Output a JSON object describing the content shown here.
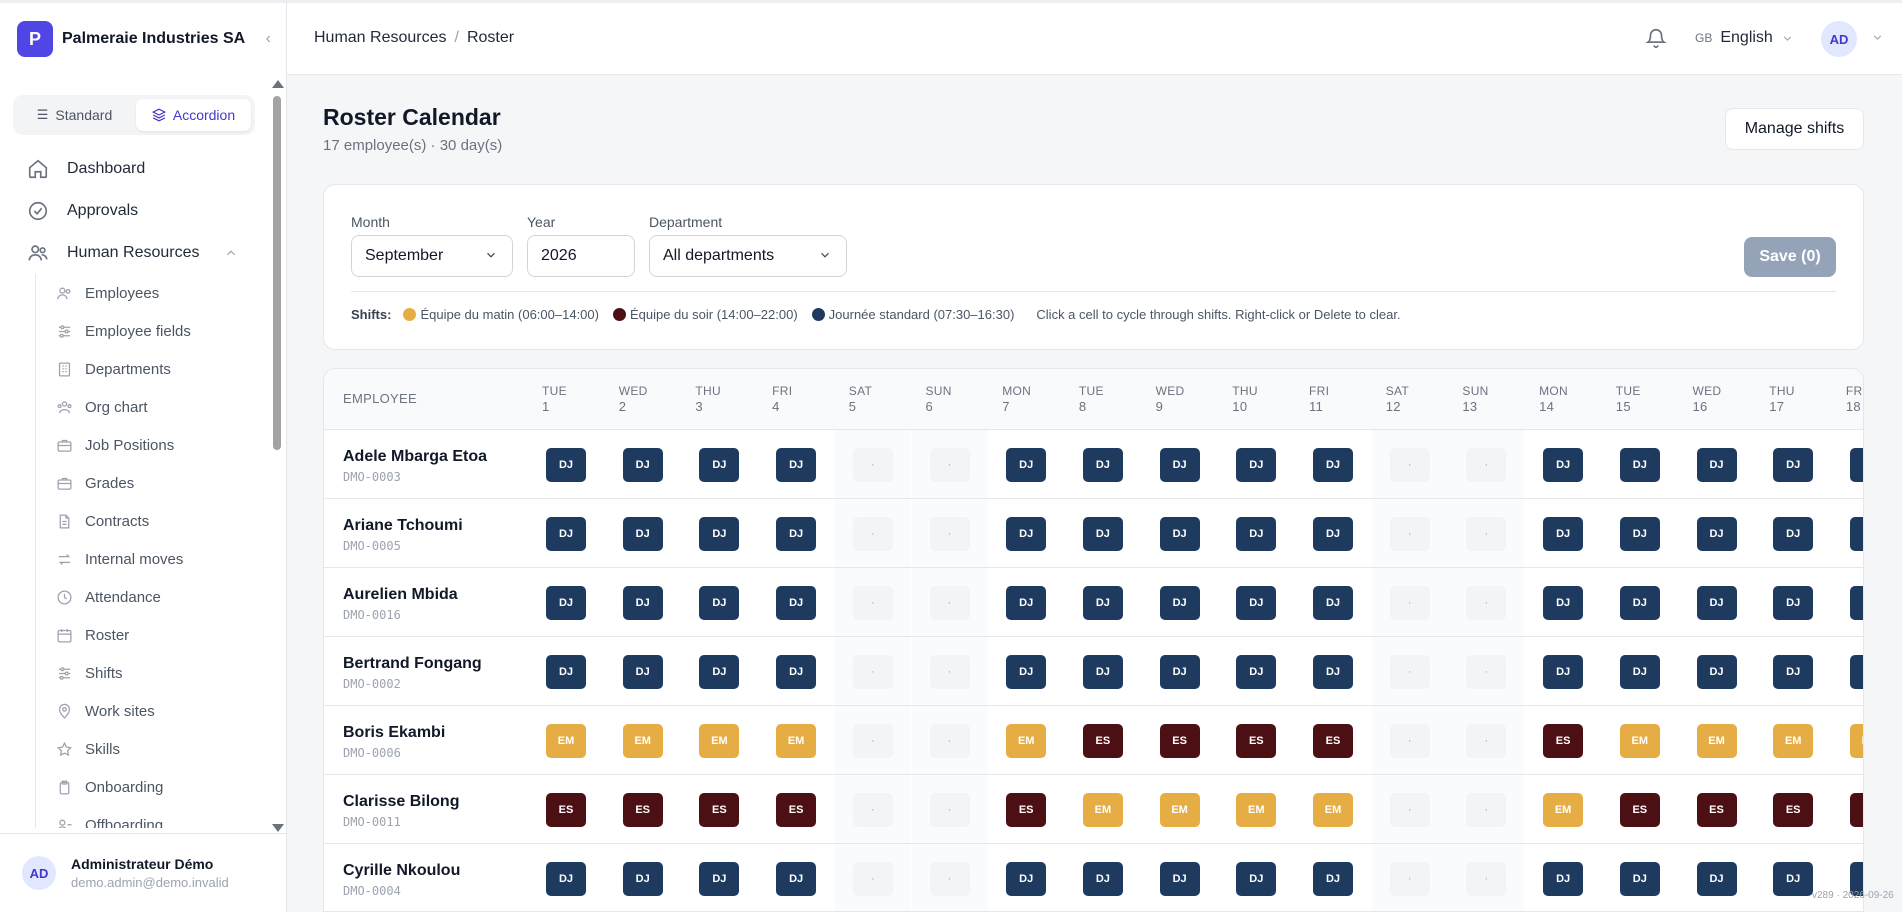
{
  "app": {
    "brand_logo_letter": "P",
    "brand_name": "Palmeraie Industries SA",
    "version": "v289 · 2026-09-26"
  },
  "sidebar": {
    "view_modes": [
      {
        "label": "Standard",
        "active": false
      },
      {
        "label": "Accordion",
        "active": true
      }
    ],
    "nav": [
      {
        "label": "Dashboard",
        "icon": "home-icon"
      },
      {
        "label": "Approvals",
        "icon": "check-circle-icon"
      },
      {
        "label": "Human Resources",
        "icon": "users-icon",
        "expanded": true
      }
    ],
    "hr_items": [
      {
        "label": "Employees",
        "icon": "users-icon"
      },
      {
        "label": "Employee fields",
        "icon": "sliders-icon"
      },
      {
        "label": "Departments",
        "icon": "building-icon"
      },
      {
        "label": "Org chart",
        "icon": "org-chart-icon"
      },
      {
        "label": "Job Positions",
        "icon": "briefcase-icon"
      },
      {
        "label": "Grades",
        "icon": "briefcase-icon"
      },
      {
        "label": "Contracts",
        "icon": "file-icon"
      },
      {
        "label": "Internal moves",
        "icon": "arrows-icon"
      },
      {
        "label": "Attendance",
        "icon": "clock-icon"
      },
      {
        "label": "Roster",
        "icon": "calendar-icon"
      },
      {
        "label": "Shifts",
        "icon": "sliders-icon"
      },
      {
        "label": "Work sites",
        "icon": "map-pin-icon"
      },
      {
        "label": "Skills",
        "icon": "star-icon"
      },
      {
        "label": "Onboarding",
        "icon": "clipboard-icon"
      },
      {
        "label": "Offboarding",
        "icon": "user-minus-icon"
      }
    ],
    "user": {
      "initials": "AD",
      "name": "Administrateur Démo",
      "email": "demo.admin@demo.invalid"
    }
  },
  "header": {
    "breadcrumb": [
      "Human Resources",
      "Roster"
    ],
    "language": {
      "flag": "GB",
      "label": "English"
    },
    "avatar_initials": "AD"
  },
  "page": {
    "title": "Roster Calendar",
    "subtitle": "17 employee(s) · 30 day(s)",
    "manage_label": "Manage shifts"
  },
  "filters": {
    "month": {
      "label": "Month",
      "value": "September"
    },
    "year": {
      "label": "Year",
      "value": "2026"
    },
    "department": {
      "label": "Department",
      "value": "All departments"
    },
    "save_label": "Save (0)",
    "shifts_label": "Shifts:",
    "legend": [
      {
        "label": "Équipe du matin (06:00–14:00)",
        "color": "#e6ad45"
      },
      {
        "label": "Équipe du soir (14:00–22:00)",
        "color": "#4c1014"
      },
      {
        "label": "Journée standard (07:30–16:30)",
        "color": "#1e3a5f"
      }
    ],
    "hint": "Click a cell to cycle through shifts. Right-click or Delete to clear."
  },
  "roster": {
    "employee_header": "EMPLOYEE",
    "off_marker": "·",
    "days": [
      {
        "dow": "TUE",
        "day": "1"
      },
      {
        "dow": "WED",
        "day": "2"
      },
      {
        "dow": "THU",
        "day": "3"
      },
      {
        "dow": "FRI",
        "day": "4"
      },
      {
        "dow": "SAT",
        "day": "5"
      },
      {
        "dow": "SUN",
        "day": "6"
      },
      {
        "dow": "MON",
        "day": "7"
      },
      {
        "dow": "TUE",
        "day": "8"
      },
      {
        "dow": "WED",
        "day": "9"
      },
      {
        "dow": "THU",
        "day": "10"
      },
      {
        "dow": "FRI",
        "day": "11"
      },
      {
        "dow": "SAT",
        "day": "12"
      },
      {
        "dow": "SUN",
        "day": "13"
      },
      {
        "dow": "MON",
        "day": "14"
      },
      {
        "dow": "TUE",
        "day": "15"
      },
      {
        "dow": "WED",
        "day": "16"
      },
      {
        "dow": "THU",
        "day": "17"
      },
      {
        "dow": "FRI",
        "day": "18"
      }
    ],
    "employees": [
      {
        "name": "Adele Mbarga Etoa",
        "code": "DMO-0003",
        "shifts": [
          "DJ",
          "DJ",
          "DJ",
          "DJ",
          "",
          "",
          "DJ",
          "DJ",
          "DJ",
          "DJ",
          "DJ",
          "",
          "",
          "DJ",
          "DJ",
          "DJ",
          "DJ",
          "DJ"
        ]
      },
      {
        "name": "Ariane Tchoumi",
        "code": "DMO-0005",
        "shifts": [
          "DJ",
          "DJ",
          "DJ",
          "DJ",
          "",
          "",
          "DJ",
          "DJ",
          "DJ",
          "DJ",
          "DJ",
          "",
          "",
          "DJ",
          "DJ",
          "DJ",
          "DJ",
          "DJ"
        ]
      },
      {
        "name": "Aurelien Mbida",
        "code": "DMO-0016",
        "shifts": [
          "DJ",
          "DJ",
          "DJ",
          "DJ",
          "",
          "",
          "DJ",
          "DJ",
          "DJ",
          "DJ",
          "DJ",
          "",
          "",
          "DJ",
          "DJ",
          "DJ",
          "DJ",
          "DJ"
        ]
      },
      {
        "name": "Bertrand Fongang",
        "code": "DMO-0002",
        "shifts": [
          "DJ",
          "DJ",
          "DJ",
          "DJ",
          "",
          "",
          "DJ",
          "DJ",
          "DJ",
          "DJ",
          "DJ",
          "",
          "",
          "DJ",
          "DJ",
          "DJ",
          "DJ",
          "DJ"
        ]
      },
      {
        "name": "Boris Ekambi",
        "code": "DMO-0006",
        "shifts": [
          "EM",
          "EM",
          "EM",
          "EM",
          "",
          "",
          "EM",
          "ES",
          "ES",
          "ES",
          "ES",
          "",
          "",
          "ES",
          "EM",
          "EM",
          "EM",
          "EM"
        ]
      },
      {
        "name": "Clarisse Bilong",
        "code": "DMO-0011",
        "shifts": [
          "ES",
          "ES",
          "ES",
          "ES",
          "",
          "",
          "ES",
          "EM",
          "EM",
          "EM",
          "EM",
          "",
          "",
          "EM",
          "ES",
          "ES",
          "ES",
          "ES"
        ]
      },
      {
        "name": "Cyrille Nkoulou",
        "code": "DMO-0004",
        "shifts": [
          "DJ",
          "DJ",
          "DJ",
          "DJ",
          "",
          "",
          "DJ",
          "DJ",
          "DJ",
          "DJ",
          "DJ",
          "",
          "",
          "DJ",
          "DJ",
          "DJ",
          "DJ",
          "DJ"
        ]
      }
    ]
  }
}
